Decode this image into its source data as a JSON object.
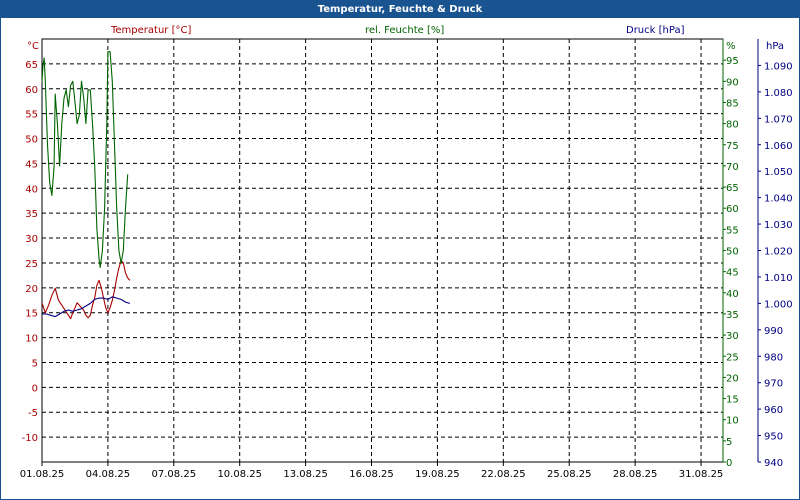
{
  "window": {
    "title": "Temperatur, Feuchte & Druck"
  },
  "colors": {
    "temperature": "#a80000",
    "humidity": "#006400",
    "pressure": "#000080",
    "title_bar": "#1a5490"
  },
  "chart_data": {
    "type": "line",
    "title": "Temperatur, Feuchte & Druck",
    "grid": true,
    "x_ticks": [
      "01.08.25",
      "04.08.25",
      "07.08.25",
      "10.08.25",
      "13.08.25",
      "16.08.25",
      "19.08.25",
      "22.08.25",
      "25.08.25",
      "28.08.25",
      "31.08.25"
    ],
    "x_range_days": [
      0,
      31
    ],
    "axes": {
      "temperature": {
        "label": "Temperatur [°C]",
        "unit": "°C",
        "ylim": [
          -15,
          70
        ],
        "ticks": [
          "-10",
          "-5",
          "0",
          "5",
          "10",
          "15",
          "20",
          "25",
          "30",
          "35",
          "40",
          "45",
          "50",
          "55",
          "60",
          "65"
        ],
        "tick_values": [
          -10,
          -5,
          0,
          5,
          10,
          15,
          20,
          25,
          30,
          35,
          40,
          45,
          50,
          55,
          60,
          65
        ]
      },
      "humidity": {
        "label": "rel. Feuchte [%]",
        "unit": "%",
        "ylim": [
          0,
          100
        ],
        "ticks": [
          "0",
          "5",
          "10",
          "15",
          "20",
          "25",
          "30",
          "35",
          "40",
          "45",
          "50",
          "55",
          "60",
          "65",
          "70",
          "75",
          "80",
          "85",
          "90",
          "95"
        ],
        "tick_values": [
          0,
          5,
          10,
          15,
          20,
          25,
          30,
          35,
          40,
          45,
          50,
          55,
          60,
          65,
          70,
          75,
          80,
          85,
          90,
          95
        ]
      },
      "pressure": {
        "label": "Druck [hPa]",
        "unit": "hPa",
        "ylim": [
          940,
          1100
        ],
        "ticks": [
          "940",
          "950",
          "960",
          "970",
          "980",
          "990",
          "1.000",
          "1.010",
          "1.020",
          "1.030",
          "1.040",
          "1.050",
          "1.060",
          "1.070",
          "1.080",
          "1.090"
        ],
        "tick_values": [
          940,
          950,
          960,
          970,
          980,
          990,
          1000,
          1010,
          1020,
          1030,
          1040,
          1050,
          1060,
          1070,
          1080,
          1090
        ]
      }
    },
    "series": [
      {
        "name": "Temperatur [°C]",
        "axis": "temperature",
        "points": [
          [
            0.0,
            17.0
          ],
          [
            0.15,
            15.0
          ],
          [
            0.3,
            16.5
          ],
          [
            0.45,
            18.5
          ],
          [
            0.6,
            19.9
          ],
          [
            0.75,
            17.5
          ],
          [
            0.9,
            16.5
          ],
          [
            1.05,
            15.5
          ],
          [
            1.2,
            14.5
          ],
          [
            1.3,
            13.8
          ],
          [
            1.4,
            15.0
          ],
          [
            1.5,
            16.0
          ],
          [
            1.6,
            17.0
          ],
          [
            1.7,
            16.5
          ],
          [
            1.8,
            16.0
          ],
          [
            1.9,
            15.5
          ],
          [
            2.0,
            14.5
          ],
          [
            2.1,
            14.0
          ],
          [
            2.2,
            14.5
          ],
          [
            2.3,
            16.5
          ],
          [
            2.4,
            18.0
          ],
          [
            2.5,
            20.5
          ],
          [
            2.6,
            21.5
          ],
          [
            2.7,
            20.0
          ],
          [
            2.8,
            18.0
          ],
          [
            2.9,
            16.0
          ],
          [
            3.0,
            15.0
          ],
          [
            3.1,
            16.0
          ],
          [
            3.2,
            17.5
          ],
          [
            3.3,
            19.5
          ],
          [
            3.4,
            22.0
          ],
          [
            3.5,
            24.0
          ],
          [
            3.6,
            25.5
          ],
          [
            3.7,
            25.0
          ],
          [
            3.8,
            23.0
          ],
          [
            3.9,
            22.0
          ],
          [
            4.0,
            21.5
          ]
        ]
      },
      {
        "name": "rel. Feuchte [%]",
        "axis": "humidity",
        "points": [
          [
            0.0,
            90.0
          ],
          [
            0.05,
            94.0
          ],
          [
            0.1,
            95.5
          ],
          [
            0.15,
            90.0
          ],
          [
            0.25,
            75.0
          ],
          [
            0.35,
            66.0
          ],
          [
            0.45,
            63.0
          ],
          [
            0.55,
            70.0
          ],
          [
            0.6,
            87.0
          ],
          [
            0.7,
            80.0
          ],
          [
            0.8,
            70.0
          ],
          [
            0.9,
            80.0
          ],
          [
            1.0,
            86.0
          ],
          [
            1.1,
            88.0
          ],
          [
            1.2,
            84.0
          ],
          [
            1.3,
            89.0
          ],
          [
            1.4,
            90.0
          ],
          [
            1.5,
            85.0
          ],
          [
            1.6,
            80.0
          ],
          [
            1.7,
            82.0
          ],
          [
            1.8,
            90.0
          ],
          [
            1.9,
            86.0
          ],
          [
            2.0,
            80.0
          ],
          [
            2.1,
            88.0
          ],
          [
            2.2,
            88.0
          ],
          [
            2.3,
            80.0
          ],
          [
            2.4,
            70.0
          ],
          [
            2.5,
            55.0
          ],
          [
            2.6,
            48.0
          ],
          [
            2.65,
            46.0
          ],
          [
            2.75,
            50.0
          ],
          [
            2.85,
            60.0
          ],
          [
            2.95,
            80.0
          ],
          [
            3.0,
            97.0
          ],
          [
            3.1,
            97.0
          ],
          [
            3.2,
            90.0
          ],
          [
            3.3,
            75.0
          ],
          [
            3.4,
            60.0
          ],
          [
            3.5,
            50.0
          ],
          [
            3.6,
            47.0
          ],
          [
            3.7,
            50.0
          ],
          [
            3.8,
            60.0
          ],
          [
            3.9,
            68.0
          ]
        ]
      },
      {
        "name": "Druck [hPa]",
        "axis": "pressure",
        "points": [
          [
            0.0,
            996.0
          ],
          [
            0.2,
            996.0
          ],
          [
            0.4,
            995.5
          ],
          [
            0.6,
            995.0
          ],
          [
            0.8,
            996.0
          ],
          [
            1.0,
            997.0
          ],
          [
            1.2,
            997.5
          ],
          [
            1.4,
            997.0
          ],
          [
            1.6,
            997.5
          ],
          [
            1.8,
            998.0
          ],
          [
            2.0,
            999.0
          ],
          [
            2.2,
            1000.0
          ],
          [
            2.4,
            1001.5
          ],
          [
            2.6,
            1002.0
          ],
          [
            2.8,
            1002.0
          ],
          [
            3.0,
            1001.5
          ],
          [
            3.2,
            1002.5
          ],
          [
            3.4,
            1002.0
          ],
          [
            3.6,
            1001.5
          ],
          [
            3.8,
            1000.5
          ],
          [
            4.0,
            1000.0
          ]
        ]
      }
    ]
  }
}
